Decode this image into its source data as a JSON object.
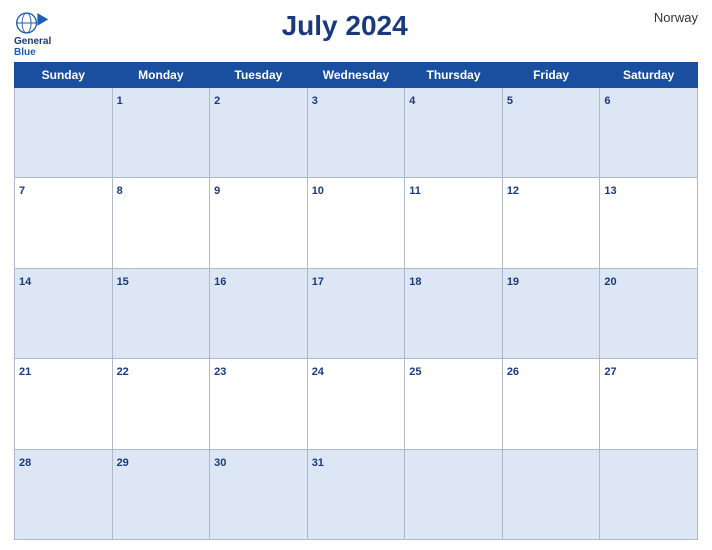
{
  "header": {
    "logo": {
      "line1": "General",
      "line2": "Blue"
    },
    "title": "July 2024",
    "country": "Norway"
  },
  "weekdays": [
    "Sunday",
    "Monday",
    "Tuesday",
    "Wednesday",
    "Thursday",
    "Friday",
    "Saturday"
  ],
  "weeks": [
    [
      null,
      1,
      2,
      3,
      4,
      5,
      6
    ],
    [
      7,
      8,
      9,
      10,
      11,
      12,
      13
    ],
    [
      14,
      15,
      16,
      17,
      18,
      19,
      20
    ],
    [
      21,
      22,
      23,
      24,
      25,
      26,
      27
    ],
    [
      28,
      29,
      30,
      31,
      null,
      null,
      null
    ]
  ],
  "dark_rows": [
    0,
    2,
    4
  ],
  "colors": {
    "header_bg": "#1a4fa0",
    "row_alt": "#dce6f5",
    "title_color": "#1a3a7c"
  }
}
